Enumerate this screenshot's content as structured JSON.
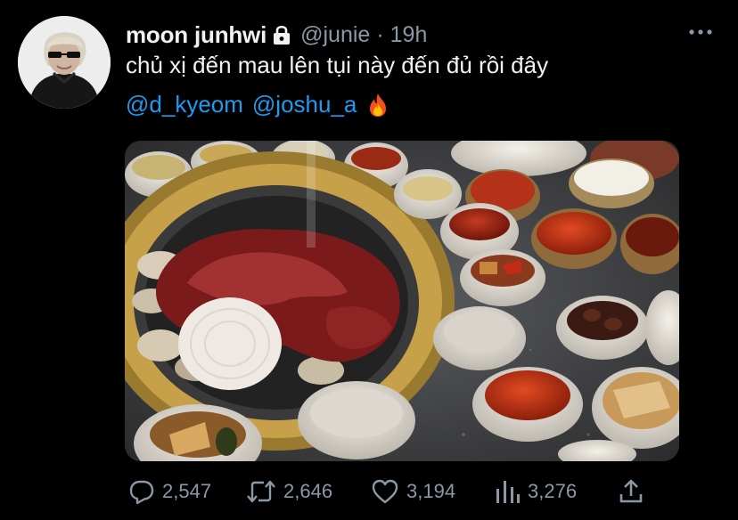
{
  "tweet": {
    "display_name": "moon junhwi",
    "handle": "@junie",
    "separator": "·",
    "time": "19h",
    "text": "chủ xị đến mau lên tụi này đến đủ rồi đây",
    "mentions": [
      "@d_kyeom",
      "@joshu_a"
    ],
    "icons": {
      "lock": "lock-icon",
      "fire": "fire-icon",
      "more": "more-icon"
    }
  },
  "actions": {
    "replies": "2,547",
    "retweets": "2,646",
    "likes": "3,194",
    "views": "3,276"
  },
  "colors": {
    "background": "#000000",
    "text": "#e7e9ea",
    "secondary": "#8b98a5",
    "link": "#1d9bf0"
  }
}
